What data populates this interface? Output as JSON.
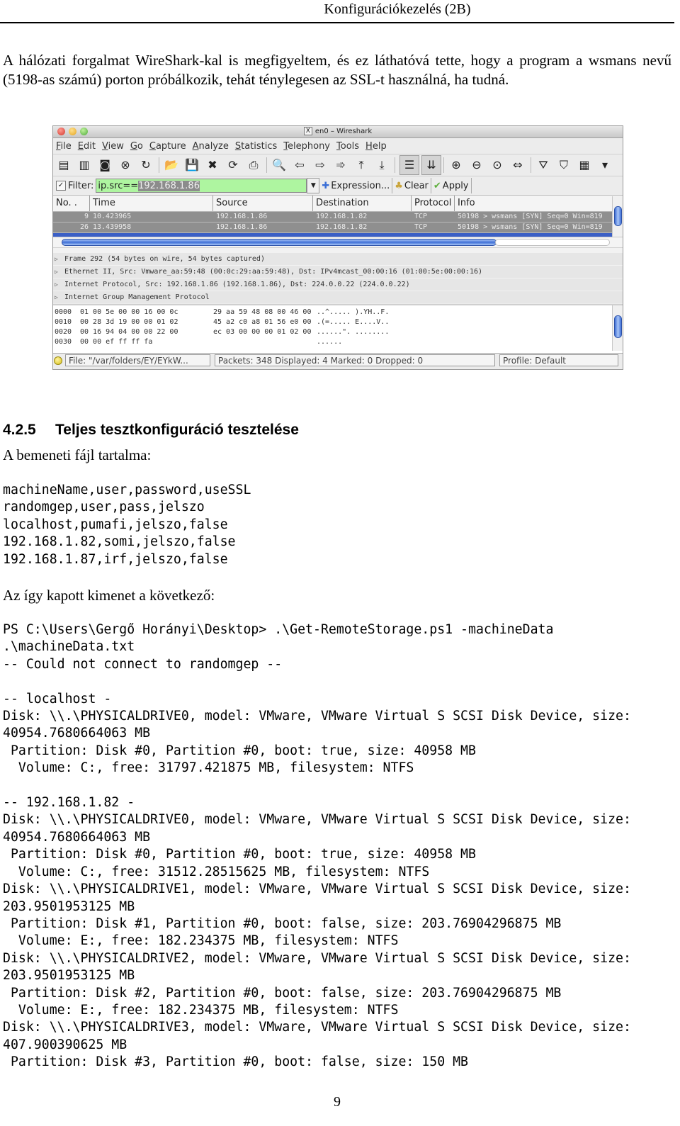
{
  "page": {
    "running_header": "Konfigurációkezelés (2B)",
    "page_number": "9"
  },
  "intro_paragraph": "A hálózati forgalmat WireShark-kal is megfigyeltem, és ez láthatóvá tette, hogy a program a wsmans nevű (5198-as számú) porton próbálkozik, tehát ténylegesen az SSL-t használná, ha tudná.",
  "wireshark": {
    "title": "en0 – Wireshark",
    "menu": [
      "File",
      "Edit",
      "View",
      "Go",
      "Capture",
      "Analyze",
      "Statistics",
      "Telephony",
      "Tools",
      "Help"
    ],
    "toolbar_icons": [
      {
        "name": "interfaces-icon",
        "glyph": "▤"
      },
      {
        "name": "capture-options-icon",
        "glyph": "▥"
      },
      {
        "name": "start-capture-icon",
        "glyph": "◙"
      },
      {
        "name": "stop-capture-icon",
        "glyph": "⊗"
      },
      {
        "name": "restart-capture-icon",
        "glyph": "↻"
      },
      {
        "name": "open-file-icon",
        "glyph": "📂"
      },
      {
        "name": "save-file-icon",
        "glyph": "💾"
      },
      {
        "name": "close-file-icon",
        "glyph": "✖"
      },
      {
        "name": "reload-icon",
        "glyph": "⟳"
      },
      {
        "name": "print-icon",
        "glyph": "⎙"
      },
      {
        "name": "find-packet-icon",
        "glyph": "🔍"
      },
      {
        "name": "go-back-icon",
        "glyph": "⇦"
      },
      {
        "name": "go-forward-icon",
        "glyph": "⇨"
      },
      {
        "name": "go-to-packet-icon",
        "glyph": "➾"
      },
      {
        "name": "first-packet-icon",
        "glyph": "⤒"
      },
      {
        "name": "last-packet-icon",
        "glyph": "⤓"
      },
      {
        "name": "colorize-icon",
        "glyph": "☰"
      },
      {
        "name": "auto-scroll-icon",
        "glyph": "⇊"
      },
      {
        "name": "zoom-in-icon",
        "glyph": "⊕"
      },
      {
        "name": "zoom-out-icon",
        "glyph": "⊖"
      },
      {
        "name": "zoom-normal-icon",
        "glyph": "⊙"
      },
      {
        "name": "resize-columns-icon",
        "glyph": "⇔"
      },
      {
        "name": "capture-filters-icon",
        "glyph": "⛛"
      },
      {
        "name": "display-filters-icon",
        "glyph": "⛉"
      },
      {
        "name": "coloring-rules-icon",
        "glyph": "▦"
      },
      {
        "name": "more-icon",
        "glyph": "▾"
      }
    ],
    "filter": {
      "label": "Filter:",
      "value_prefix": "ip.src==",
      "value_selected": "192.168.1.86",
      "expression_label": "Expression...",
      "clear_label": "Clear",
      "apply_label": "Apply"
    },
    "columns": [
      "No. .",
      "Time",
      "Source",
      "Destination",
      "Protocol",
      "Info"
    ],
    "packets": [
      {
        "no": "9",
        "time": "10.423965",
        "source": "192.168.1.86",
        "destination": "192.168.1.82",
        "protocol": "TCP",
        "info": "50198 > wsmans [SYN] Seq=0 Win=819"
      },
      {
        "no": "26",
        "time": "13.439958",
        "source": "192.168.1.86",
        "destination": "192.168.1.82",
        "protocol": "TCP",
        "info": "50198 > wsmans [SYN] Seq=0 Win=819"
      }
    ],
    "details": [
      "Frame 292 (54 bytes on wire, 54 bytes captured)",
      "Ethernet II, Src: Vmware_aa:59:48 (00:0c:29:aa:59:48), Dst: IPv4mcast_00:00:16 (01:00:5e:00:00:16)",
      "Internet Protocol, Src: 192.168.1.86 (192.168.1.86), Dst: 224.0.0.22 (224.0.0.22)",
      "Internet Group Management Protocol"
    ],
    "hex": [
      {
        "offset": "0000",
        "a": "01 00 5e 00 00 16 00 0c",
        "b": "29 aa 59 48 08 00 46 00",
        "ascii": "..^..... ).YH..F."
      },
      {
        "offset": "0010",
        "a": "00 28 3d 19 00 00 01 02",
        "b": "45 a2 c0 a8 01 56 e0 00",
        "ascii": ".(=..... E....V.."
      },
      {
        "offset": "0020",
        "a": "00 16 94 04 00 00 22 00",
        "b": "ec 03 00 00 00 01 02 00",
        "ascii": "......\". ........"
      },
      {
        "offset": "0030",
        "a": "00 00 ef ff ff fa",
        "b": "",
        "ascii": "......"
      }
    ],
    "status": {
      "file": "File: \"/var/folders/EY/EYkW...",
      "packets": "Packets: 348 Displayed: 4 Marked: 0 Dropped: 0",
      "profile": "Profile: Default"
    }
  },
  "section": {
    "number": "4.2.5",
    "title": "Teljes tesztkonfiguráció tesztelése"
  },
  "input_intro": "A bemeneti fájl tartalma:",
  "input_file_lines": [
    "machineName,user,password,useSSL",
    "randomgep,user,pass,jelszo",
    "localhost,pumafi,jelszo,false",
    "192.168.1.82,somi,jelszo,false",
    "192.168.1.87,irf,jelszo,false"
  ],
  "output_intro": "Az így kapott kimenet a következő:",
  "output_lines": [
    "PS C:\\Users\\Gergő Horányi\\Desktop> .\\Get-RemoteStorage.ps1 -machineData",
    ".\\machineData.txt",
    "-- Could not connect to randomgep --",
    "",
    "-- localhost -",
    "Disk: \\\\.\\PHYSICALDRIVE0, model: VMware, VMware Virtual S SCSI Disk Device, size:",
    "40954.7680664063 MB",
    " Partition: Disk #0, Partition #0, boot: true, size: 40958 MB",
    "  Volume: C:, free: 31797.421875 MB, filesystem: NTFS",
    "",
    "-- 192.168.1.82 -",
    "Disk: \\\\.\\PHYSICALDRIVE0, model: VMware, VMware Virtual S SCSI Disk Device, size:",
    "40954.7680664063 MB",
    " Partition: Disk #0, Partition #0, boot: true, size: 40958 MB",
    "  Volume: C:, free: 31512.28515625 MB, filesystem: NTFS",
    "Disk: \\\\.\\PHYSICALDRIVE1, model: VMware, VMware Virtual S SCSI Disk Device, size:",
    "203.9501953125 MB",
    " Partition: Disk #1, Partition #0, boot: false, size: 203.76904296875 MB",
    "  Volume: E:, free: 182.234375 MB, filesystem: NTFS",
    "Disk: \\\\.\\PHYSICALDRIVE2, model: VMware, VMware Virtual S SCSI Disk Device, size:",
    "203.9501953125 MB",
    " Partition: Disk #2, Partition #0, boot: false, size: 203.76904296875 MB",
    "  Volume: E:, free: 182.234375 MB, filesystem: NTFS",
    "Disk: \\\\.\\PHYSICALDRIVE3, model: VMware, VMware Virtual S SCSI Disk Device, size:",
    "407.900390625 MB",
    " Partition: Disk #3, Partition #0, boot: false, size: 150 MB"
  ]
}
